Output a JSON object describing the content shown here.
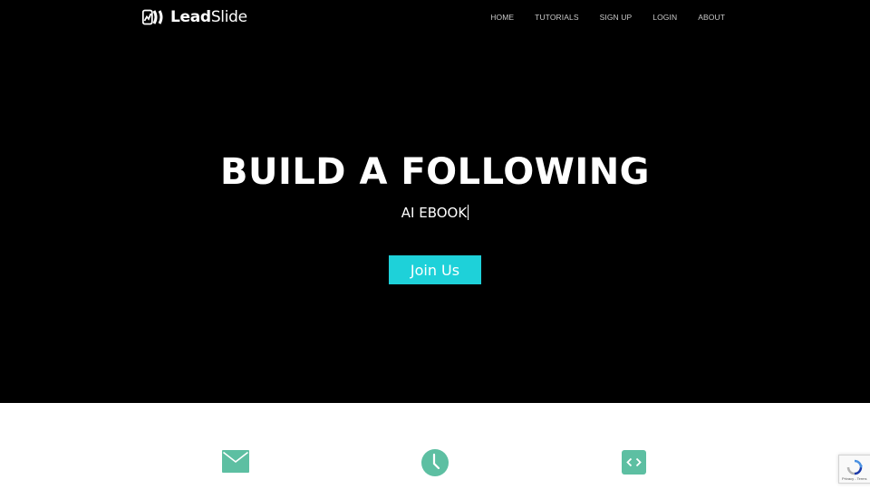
{
  "brand": {
    "name_bold": "Lead",
    "name_regular": "Slide"
  },
  "nav": {
    "items": [
      {
        "label": "HOME"
      },
      {
        "label": "TUTORIALS"
      },
      {
        "label": "SIGN UP"
      },
      {
        "label": "LOGIN"
      },
      {
        "label": "ABOUT"
      }
    ]
  },
  "hero": {
    "headline": "BUILD A FOLLOWING",
    "typed_text": "AI EBOOK",
    "cta_label": "Join Us"
  },
  "features": {
    "icons": [
      "envelope-icon",
      "clock-icon",
      "code-icon"
    ]
  },
  "recaptcha": {
    "links": "Privacy - Terms"
  },
  "colors": {
    "hero_bg": "#000000",
    "accent": "#1ed1d9",
    "feature_icon": "#5dbfa2",
    "nav_text": "#c9c9c9"
  }
}
